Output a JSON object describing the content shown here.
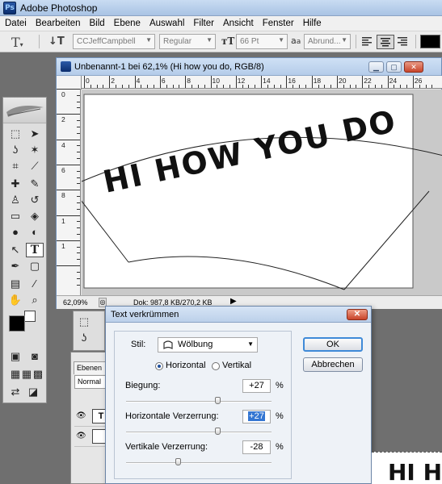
{
  "app": {
    "title": "Adobe Photoshop",
    "logo": "Ps"
  },
  "menu": [
    "Datei",
    "Bearbeiten",
    "Bild",
    "Ebene",
    "Auswahl",
    "Filter",
    "Ansicht",
    "Fenster",
    "Hilfe"
  ],
  "options": {
    "font_family": "CCJeffCampbell",
    "font_style": "Regular",
    "font_size": "66 Pt",
    "aa_label": "a",
    "antialias": "Abrund..."
  },
  "document": {
    "title": "Unbenannt-1 bei 62,1% (Hi how you do, RGB/8)",
    "zoom": "62,09%",
    "doc_info": "Dok: 987,8 KB/270,2 KB",
    "canvas_text": "HI HOW YOU DO",
    "h_ruler": [
      "0",
      "2",
      "4",
      "6",
      "8",
      "10",
      "12",
      "14",
      "16",
      "18",
      "20",
      "22",
      "24",
      "26"
    ],
    "v_ruler": [
      "0",
      "2",
      "4",
      "6",
      "8",
      "1",
      "1"
    ]
  },
  "layers": {
    "tab": "Ebenen",
    "mode": "Normal",
    "layer_thumb": "T"
  },
  "dialog": {
    "title": "Text verkrümmen",
    "stil_label": "Stil:",
    "stil_value": "Wölbung",
    "horizontal_label": "Horizontal",
    "vertical_label": "Vertikal",
    "orientation_selected": "horizontal",
    "bend_label": "Biegung:",
    "bend_value": "+27",
    "hdist_label": "Horizontale Verzerrung:",
    "hdist_value": "+27",
    "vdist_label": "Vertikale Verzerrung:",
    "vdist_value": "-28",
    "percent": "%",
    "ok": "OK",
    "cancel": "Abbrechen"
  },
  "preview_text": "HI H"
}
